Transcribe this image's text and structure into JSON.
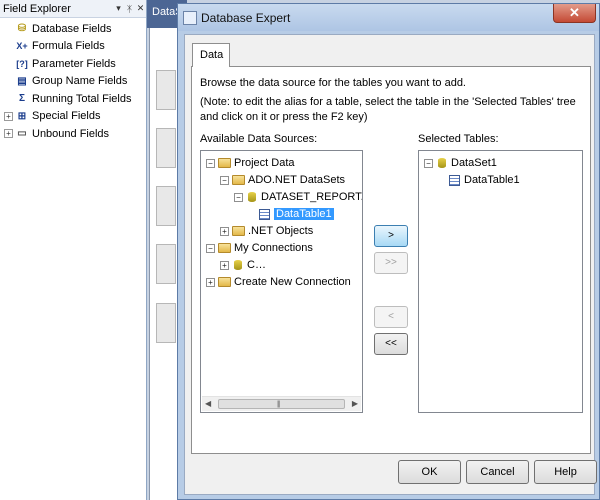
{
  "field_explorer": {
    "title": "Field Explorer",
    "pin_glyph": "▾ ⫰",
    "close_glyph": "✕",
    "items": [
      {
        "label": "Database Fields",
        "icon": "database-icon",
        "expandable": false
      },
      {
        "label": "Formula Fields",
        "icon": "formula-icon",
        "expandable": false
      },
      {
        "label": "Parameter Fields",
        "icon": "parameter-icon",
        "expandable": false
      },
      {
        "label": "Group Name Fields",
        "icon": "group-icon",
        "expandable": false
      },
      {
        "label": "Running Total Fields",
        "icon": "sigma-icon",
        "expandable": false
      },
      {
        "label": "Special Fields",
        "icon": "special-icon",
        "expandable": true
      },
      {
        "label": "Unbound Fields",
        "icon": "unbound-icon",
        "expandable": true
      }
    ]
  },
  "background": {
    "tab_label": "DataS"
  },
  "dialog": {
    "title": "Database Expert",
    "close": "✕",
    "tab": "Data",
    "description": "Browse the data source for the tables you want to add.",
    "note": "(Note: to edit the alias for a table, select the table in the 'Selected Tables' tree and click on it or press the F2 key)",
    "available_label": "Available Data Sources:",
    "selected_label": "Selected Tables:",
    "available_tree": {
      "project_data": "Project Data",
      "ado_datasets": "ADO.NET DataSets",
      "dataset_report": "DATASET_REPORT.DataSet",
      "datatable": "DataTable1",
      "net_objects": ".NET Objects",
      "my_connections": "My Connections",
      "connection_item": "C…",
      "create_new": "Create New Connection"
    },
    "selected_tree": {
      "dataset": "DataSet1",
      "datatable": "DataTable1"
    },
    "move_buttons": {
      "add_one": ">",
      "add_all": ">>",
      "remove_one": "<",
      "remove_all": "<<"
    },
    "buttons": {
      "ok": "OK",
      "cancel": "Cancel",
      "help": "Help"
    }
  }
}
